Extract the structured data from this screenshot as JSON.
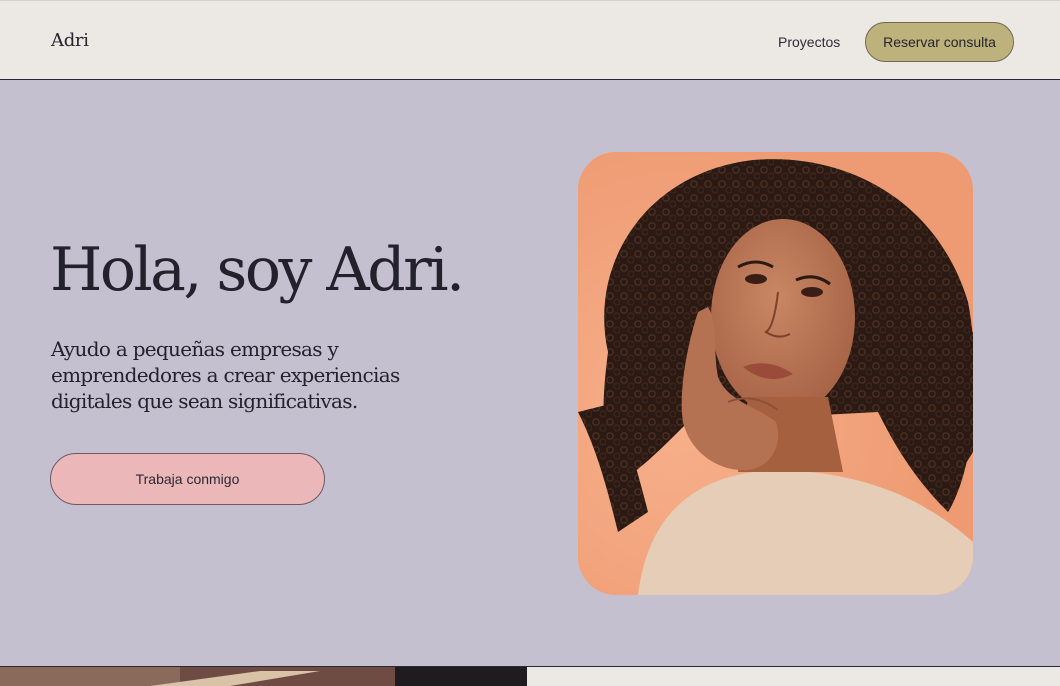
{
  "header": {
    "logo": "Adri",
    "nav": {
      "projects_label": "Proyectos",
      "cta_label": "Reservar consulta"
    }
  },
  "hero": {
    "title": "Hola, soy Adri.",
    "subtitle": "Ayudo a pequeñas empresas y emprendedores a crear experiencias digitales que sean significativas.",
    "button_label": "Trabaja conmigo"
  },
  "colors": {
    "header_bg": "#ece9e4",
    "hero_bg": "#c4c0d0",
    "header_cta_bg": "#beb27c",
    "hero_button_bg": "#ebb7b8",
    "portrait_bg": "#f2a27c",
    "text": "#22212c"
  },
  "icons": {
    "portrait": "woman-portrait-photo",
    "bottom_photo": "preview-photo"
  }
}
